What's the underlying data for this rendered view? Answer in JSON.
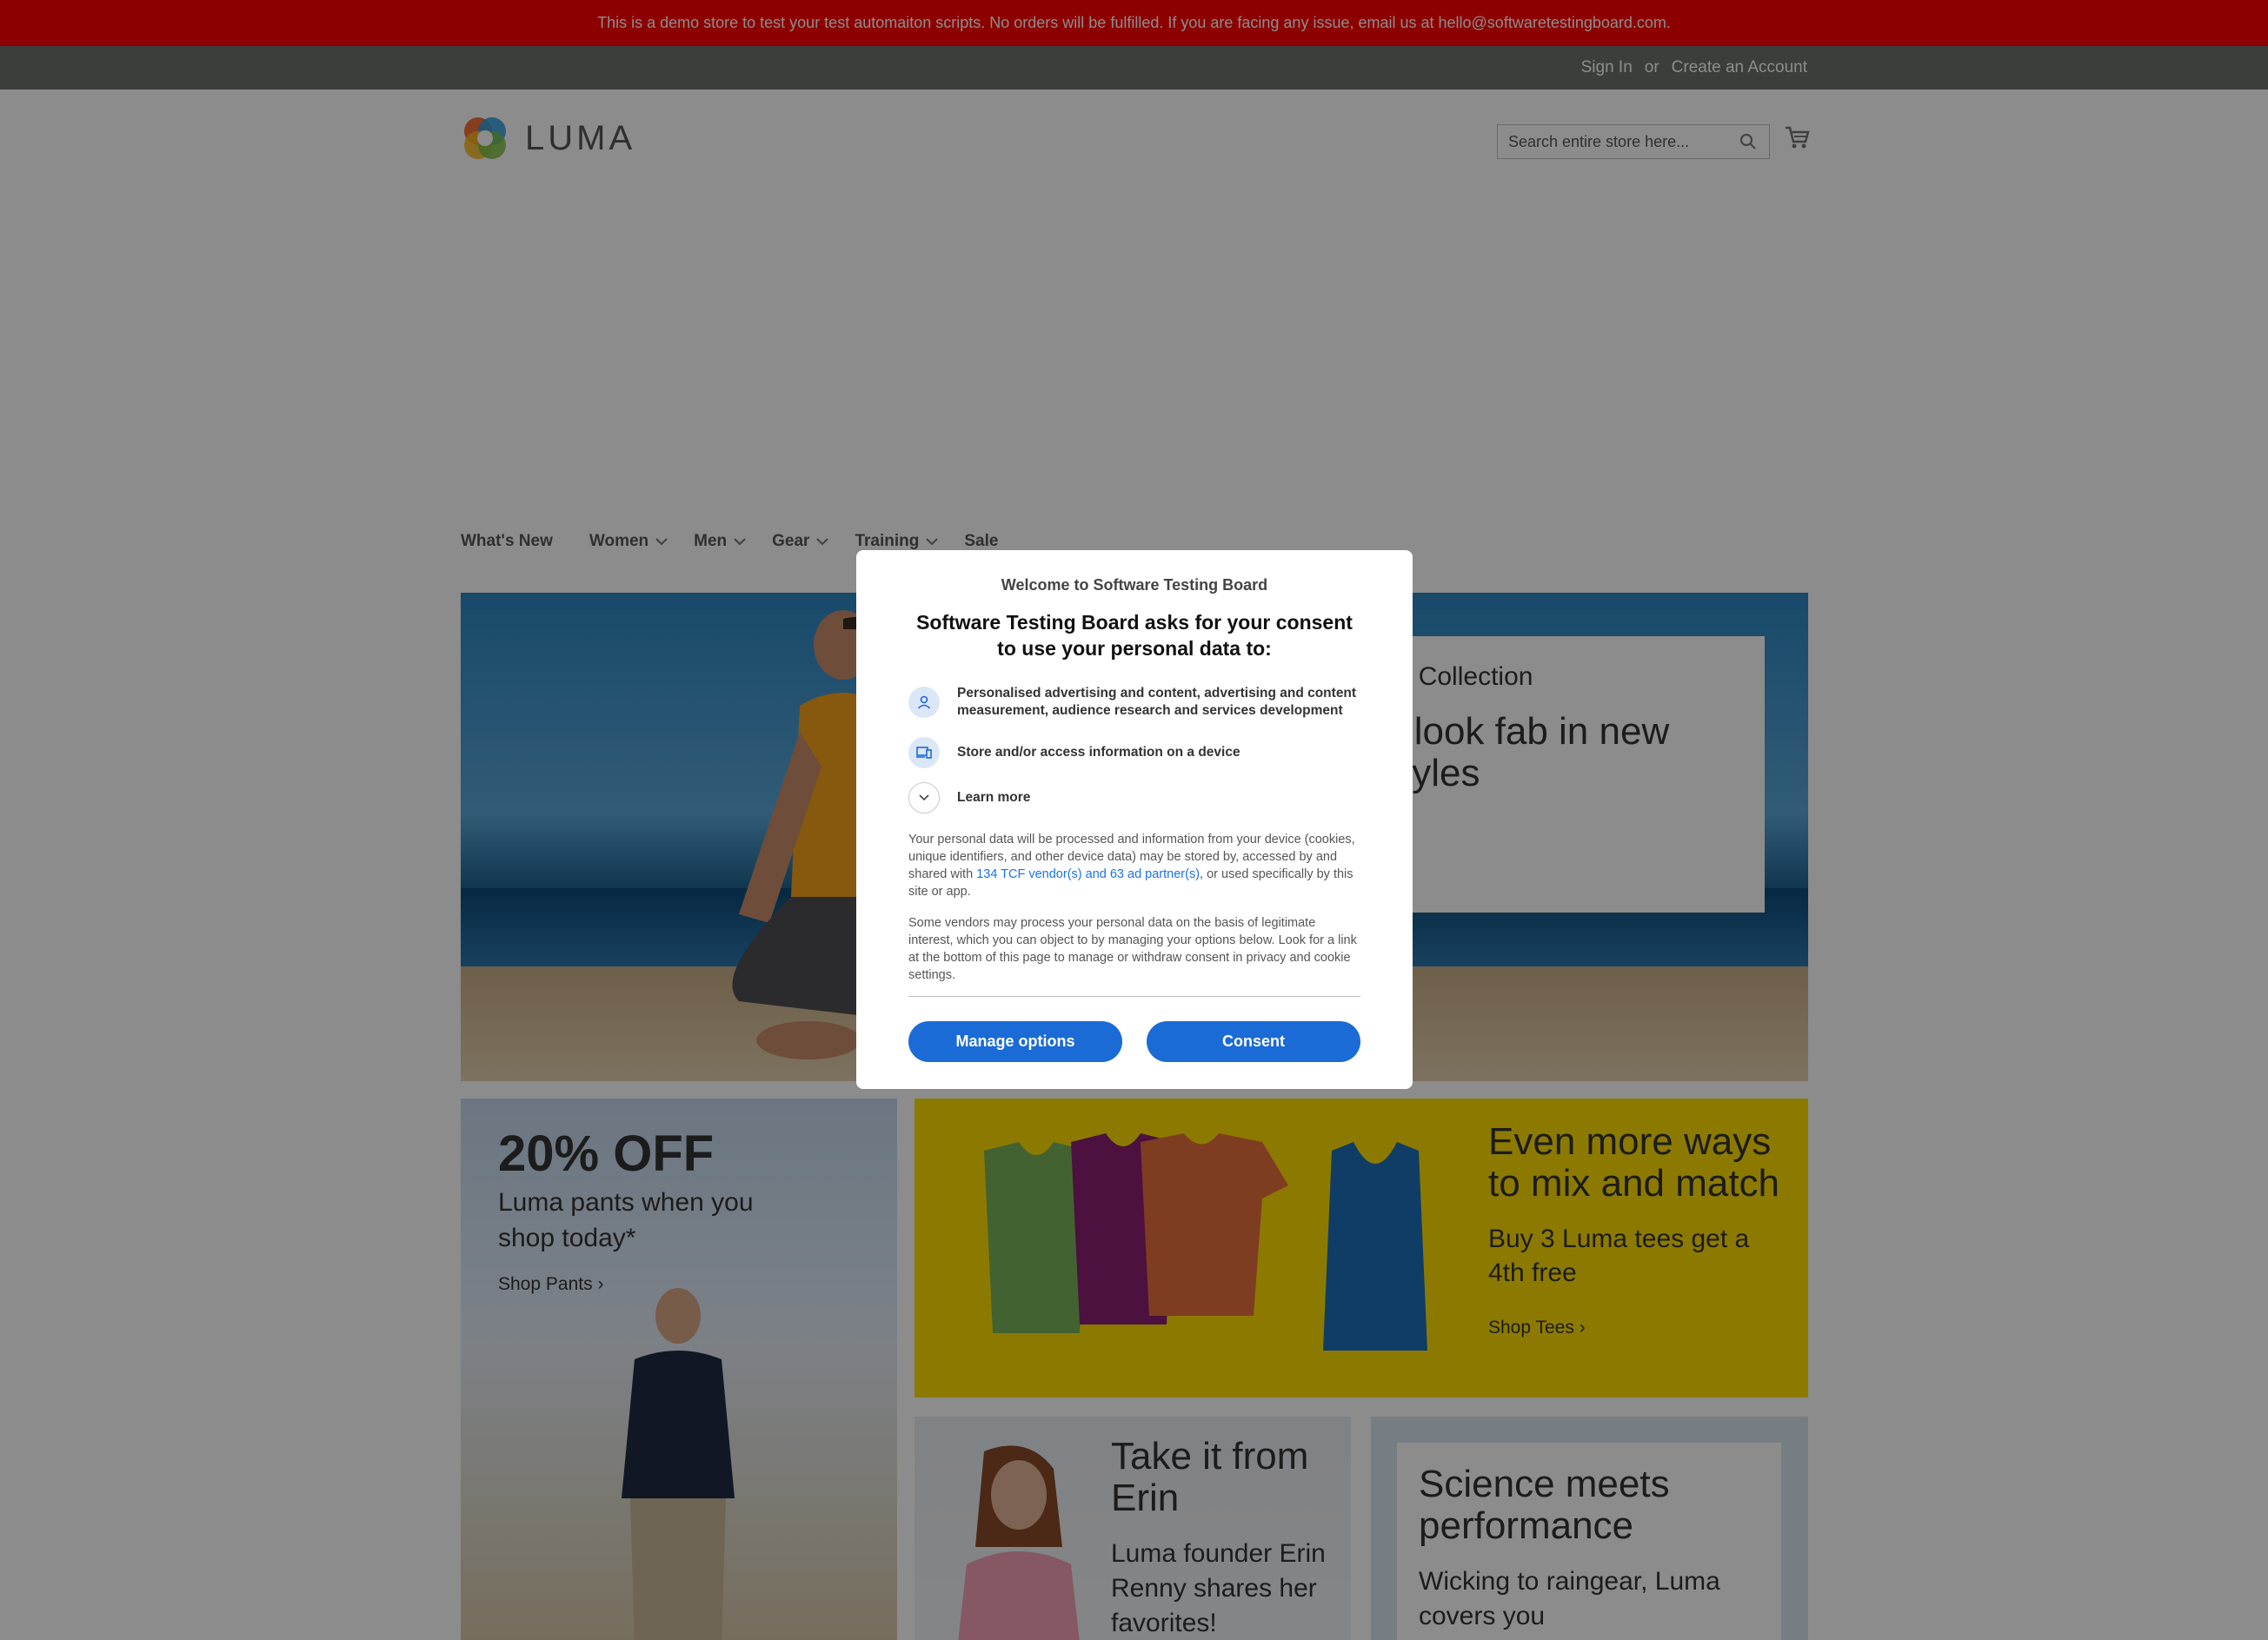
{
  "demo_notice": "This is a demo store to test your test automaiton scripts. No orders will be fulfilled. If you are facing any issue, email us at hello@softwaretestingboard.com.",
  "header": {
    "sign_in": "Sign In",
    "or": "or",
    "create_account": "Create an Account"
  },
  "logo": {
    "text": "LUMA"
  },
  "search": {
    "placeholder": "Search entire store here..."
  },
  "nav": {
    "items": [
      {
        "label": "What's New"
      },
      {
        "label": "Women"
      },
      {
        "label": "Men"
      },
      {
        "label": "Gear"
      },
      {
        "label": "Training"
      },
      {
        "label": "Sale"
      }
    ]
  },
  "hero": {
    "kicker": "ga Collection",
    "headline": "d look fab in new styles"
  },
  "promos": {
    "pants": {
      "title": "20% OFF",
      "subtitle": "Luma pants when you shop today*",
      "link": "Shop Pants"
    },
    "tees": {
      "title": "Even more ways to mix and match",
      "subtitle": "Buy 3 Luma tees get a 4th free",
      "link": "Shop Tees"
    },
    "erin": {
      "title": "Take it from Erin",
      "subtitle": "Luma founder Erin Renny shares her favorites!"
    },
    "science": {
      "title": "Science meets performance",
      "subtitle": "Wicking to raingear, Luma covers you"
    }
  },
  "modal": {
    "welcome": "Welcome to Software Testing Board",
    "title": "Software Testing Board asks for your consent to use your personal data to:",
    "purposes": [
      {
        "icon": "person-icon",
        "text": "Personalised advertising and content, advertising and content measurement, audience research and services development"
      },
      {
        "icon": "devices-icon",
        "text": "Store and/or access information on a device"
      }
    ],
    "learn_more": "Learn more",
    "paragraph1_before": "Your personal data will be processed and information from your device (cookies, unique identifiers, and other device data) may be stored by, accessed by and shared with ",
    "paragraph1_link": "134 TCF vendor(s) and 63 ad partner(s)",
    "paragraph1_after": ", or used specifically by this site or app.",
    "paragraph2": "Some vendors may process your personal data on the basis of legitimate interest, which you can object to by managing your options below. Look for a link at the bottom of this page to manage or withdraw consent in privacy and cookie settings.",
    "manage_options": "Manage options",
    "consent": "Consent"
  },
  "colors": {
    "demo_bar": "#ff0101",
    "panel_header": "#6e716e",
    "primary_button": "#1a6bd6",
    "link": "#1a73e8",
    "tees_tile": "#ffdf00"
  }
}
